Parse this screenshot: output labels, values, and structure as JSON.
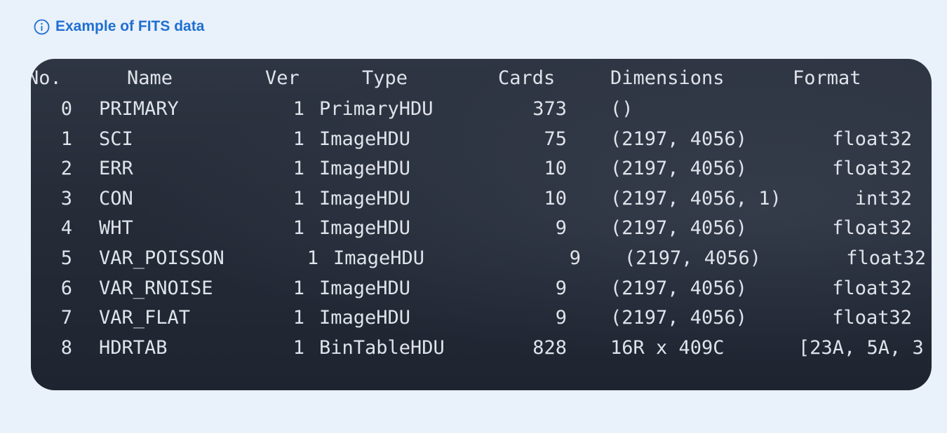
{
  "callout": {
    "icon": "info-icon",
    "title": "Example of FITS data"
  },
  "terminal": {
    "headers": {
      "no": "No.",
      "name": "Name",
      "ver": "Ver",
      "type": "Type",
      "cards": "Cards",
      "dimensions": "Dimensions",
      "format": "Format"
    },
    "rows": [
      {
        "no": "0",
        "name": "PRIMARY",
        "ver": "1",
        "type": "PrimaryHDU",
        "cards": "373",
        "dimensions": "()",
        "format": ""
      },
      {
        "no": "1",
        "name": "SCI",
        "ver": "1",
        "type": "ImageHDU",
        "cards": "75",
        "dimensions": "(2197, 4056)",
        "format": "float32"
      },
      {
        "no": "2",
        "name": "ERR",
        "ver": "1",
        "type": "ImageHDU",
        "cards": "10",
        "dimensions": "(2197, 4056)",
        "format": "float32"
      },
      {
        "no": "3",
        "name": "CON",
        "ver": "1",
        "type": "ImageHDU",
        "cards": "10",
        "dimensions": "(2197, 4056, 1)",
        "format": "int32"
      },
      {
        "no": "4",
        "name": "WHT",
        "ver": "1",
        "type": "ImageHDU",
        "cards": "9",
        "dimensions": "(2197, 4056)",
        "format": "float32"
      },
      {
        "no": "5",
        "name": "VAR_POISSON",
        "ver": "1",
        "type": "ImageHDU",
        "cards": "9",
        "dimensions": "(2197, 4056)",
        "format": "float32"
      },
      {
        "no": "6",
        "name": "VAR_RNOISE",
        "ver": "1",
        "type": "ImageHDU",
        "cards": "9",
        "dimensions": "(2197, 4056)",
        "format": "float32"
      },
      {
        "no": "7",
        "name": "VAR_FLAT",
        "ver": "1",
        "type": "ImageHDU",
        "cards": "9",
        "dimensions": "(2197, 4056)",
        "format": "float32"
      },
      {
        "no": "8",
        "name": "HDRTAB",
        "ver": "1",
        "type": "BinTableHDU",
        "cards": "828",
        "dimensions": "16R x 409C",
        "format": "[23A, 5A, 3"
      }
    ]
  },
  "colors": {
    "accent": "#1f6fd1",
    "background": "#e9f1fb",
    "terminal_bg": "#262c38",
    "terminal_text": "#dfe3ea"
  }
}
